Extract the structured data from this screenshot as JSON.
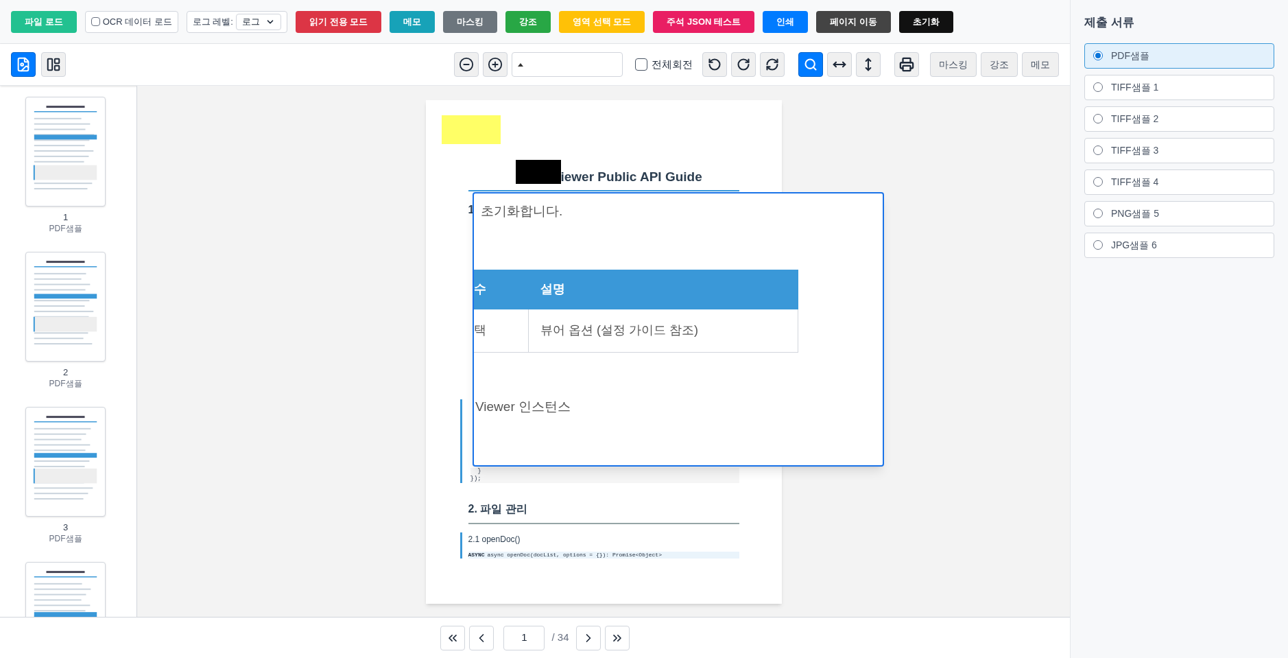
{
  "top_toolbar": [
    {
      "kind": "button",
      "label": "파일 로드",
      "color": "#22c190"
    },
    {
      "kind": "checkbox",
      "label": "OCR 데이터 로드",
      "checked": false
    },
    {
      "kind": "select",
      "label": "로그 레벨:",
      "value": "로그"
    },
    {
      "kind": "button",
      "label": "읽기 전용 모드",
      "color": "#dc3545"
    },
    {
      "kind": "button",
      "label": "메모",
      "color": "#17a2b8"
    },
    {
      "kind": "button",
      "label": "마스킹",
      "color": "#6c757d"
    },
    {
      "kind": "button",
      "label": "강조",
      "color": "#28a745"
    },
    {
      "kind": "button",
      "label": "영역 선택 모드",
      "color": "#ffc107"
    },
    {
      "kind": "button",
      "label": "주석 JSON 테스트",
      "color": "#e91e63"
    },
    {
      "kind": "button",
      "label": "인쇄",
      "color": "#007bff"
    },
    {
      "kind": "button",
      "label": "페이지 이동",
      "color": "#444444"
    },
    {
      "kind": "button",
      "label": "초기화",
      "color": "#111111"
    }
  ],
  "view_toolbar": {
    "view_modes": [
      {
        "kind": "image",
        "selected": true
      },
      {
        "kind": "grid",
        "selected": false
      }
    ],
    "rotate_all": {
      "label": "전체회전",
      "checked": false
    },
    "rotate_tools": [
      {
        "kind": "left"
      },
      {
        "kind": "right"
      },
      {
        "kind": "half"
      }
    ],
    "fit_tools": [
      {
        "kind": "zoom",
        "selected": true
      },
      {
        "kind": "width",
        "selected": false
      },
      {
        "kind": "height",
        "selected": false
      }
    ],
    "annotation_buttons": [
      "마스킹",
      "강조",
      "메모"
    ]
  },
  "thumbnails": [
    {
      "kind": "page",
      "number": "1",
      "label": "PDF샘플"
    },
    {
      "kind": "page",
      "number": "2",
      "label": "PDF샘플"
    },
    {
      "kind": "page",
      "number": "3",
      "label": "PDF샘플"
    },
    {
      "kind": "page"
    }
  ],
  "document": {
    "annotations": [
      {
        "kind": "highlight"
      },
      {
        "kind": "mask"
      }
    ],
    "title": "iewer Public API Guide",
    "fragment": "1",
    "code_tail": [
      "  }",
      "});"
    ],
    "section_2": "2. 파일 관리",
    "subsection": "2.1 openDoc()",
    "signature_tag": "ASYNC",
    "signature": "async openDoc(docList, options = {}): Promise<Object>"
  },
  "popup": {
    "text": "초기화합니다.",
    "table": {
      "columns": [
        "수",
        "설명"
      ],
      "rows": [
        [
          "택",
          "뷰어 옵션 (설정 가이드 참조)"
        ]
      ]
    },
    "footer": "Viewer 인스턴스"
  },
  "pagination": {
    "page": "1",
    "total": "/ 34"
  },
  "sidebar": {
    "title": "제출 서류",
    "documents": [
      {
        "label": "PDF샘플",
        "selected": true
      },
      {
        "label": "TIFF샘플 1",
        "selected": false
      },
      {
        "label": "TIFF샘플 2",
        "selected": false
      },
      {
        "label": "TIFF샘플 3",
        "selected": false
      },
      {
        "label": "TIFF샘플 4",
        "selected": false
      },
      {
        "label": "PNG샘플 5",
        "selected": false
      },
      {
        "label": "JPG샘플 6",
        "selected": false
      }
    ]
  }
}
